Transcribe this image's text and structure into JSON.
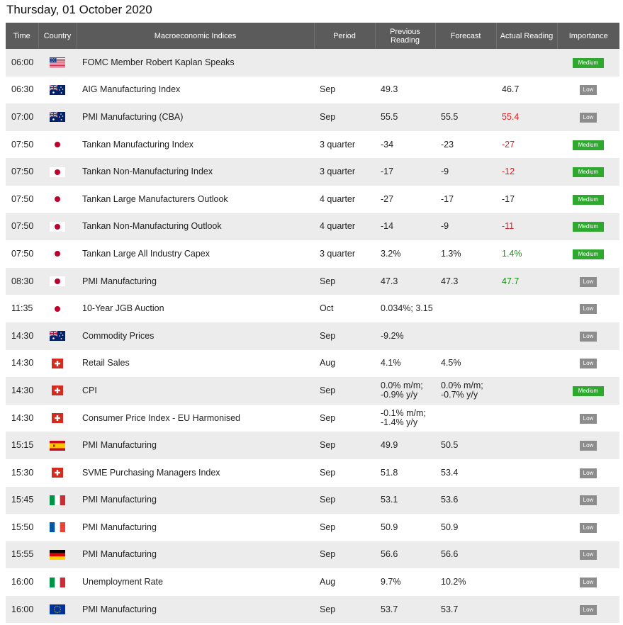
{
  "page_title": "Thursday, 01 October 2020",
  "headers": {
    "time": "Time",
    "country": "Country",
    "indices": "Macroeconomic Indices",
    "period": "Period",
    "previous_line1": "Previous",
    "previous_line2": "Reading",
    "forecast": "Forecast",
    "actual": "Actual Reading",
    "importance": "Importance"
  },
  "colors": {
    "header_bg": "#5b5b5b",
    "medium": "#2fa82f",
    "low": "#8c8c8c",
    "negative": "#e02020",
    "positive": "#1e8f1e"
  },
  "rows": [
    {
      "time": "06:00",
      "flag": "us-flag-icon",
      "index": "FOMC Member Robert Kaplan Speaks",
      "period": "",
      "prev": "",
      "forecast": "",
      "actual": "",
      "actual_color": "",
      "importance": "Medium"
    },
    {
      "time": "06:30",
      "flag": "au-flag-icon",
      "index": "AIG Manufacturing Index",
      "period": "Sep",
      "prev": "49.3",
      "forecast": "",
      "actual": "46.7",
      "actual_color": "",
      "importance": "Low"
    },
    {
      "time": "07:00",
      "flag": "au-flag-icon",
      "index": "PMI Manufacturing (CBA)",
      "period": "Sep",
      "prev": "55.5",
      "forecast": "55.5",
      "actual": "55.4",
      "actual_color": "red",
      "importance": "Low"
    },
    {
      "time": "07:50",
      "flag": "jp-flag-icon",
      "index": "Tankan Manufacturing Index",
      "period": "3 quarter",
      "prev": "-34",
      "forecast": "-23",
      "actual": "-27",
      "actual_color": "red",
      "importance": "Medium"
    },
    {
      "time": "07:50",
      "flag": "jp-flag-icon",
      "index": "Tankan Non-Manufacturing Index",
      "period": "3 quarter",
      "prev": "-17",
      "forecast": "-9",
      "actual": "-12",
      "actual_color": "red",
      "importance": "Medium"
    },
    {
      "time": "07:50",
      "flag": "jp-flag-icon",
      "index": "Tankan Large Manufacturers Outlook",
      "period": "4 quarter",
      "prev": "-27",
      "forecast": "-17",
      "actual": "-17",
      "actual_color": "",
      "importance": "Medium"
    },
    {
      "time": "07:50",
      "flag": "jp-flag-icon",
      "index": "Tankan Non-Manufacturing Outlook",
      "period": "4 quarter",
      "prev": "-14",
      "forecast": "-9",
      "actual": "-11",
      "actual_color": "red",
      "importance": "Medium"
    },
    {
      "time": "07:50",
      "flag": "jp-flag-icon",
      "index": "Tankan Large All Industry Capex",
      "period": "3 quarter",
      "prev": "3.2%",
      "forecast": "1.3%",
      "actual": "1.4%",
      "actual_color": "green",
      "importance": "Medium"
    },
    {
      "time": "08:30",
      "flag": "jp-flag-icon",
      "index": "PMI Manufacturing",
      "period": "Sep",
      "prev": "47.3",
      "forecast": "47.3",
      "actual": "47.7",
      "actual_color": "green",
      "importance": "Low"
    },
    {
      "time": "11:35",
      "flag": "jp-flag-icon",
      "index": "10-Year JGB Auction",
      "period": "Oct",
      "prev": "0.034%; 3.15",
      "forecast": "",
      "actual": "",
      "actual_color": "",
      "importance": "Low"
    },
    {
      "time": "14:30",
      "flag": "au-flag-icon",
      "index": "Commodity Prices",
      "period": "Sep",
      "prev": "-9.2%",
      "forecast": "",
      "actual": "",
      "actual_color": "",
      "importance": "Low"
    },
    {
      "time": "14:30",
      "flag": "ch-flag-icon",
      "index": "Retail Sales",
      "period": "Aug",
      "prev": "4.1%",
      "forecast": "4.5%",
      "actual": "",
      "actual_color": "",
      "importance": "Low"
    },
    {
      "time": "14:30",
      "flag": "ch-flag-icon",
      "index": "CPI",
      "period": "Sep",
      "prev": "0.0% m/m; -0.9% y/y",
      "forecast": "0.0% m/m; -0.7% y/y",
      "actual": "",
      "actual_color": "",
      "importance": "Medium"
    },
    {
      "time": "14:30",
      "flag": "ch-flag-icon",
      "index": "Consumer Price Index - EU Harmonised",
      "period": "Sep",
      "prev": "-0.1% m/m; -1.4% y/y",
      "forecast": "",
      "actual": "",
      "actual_color": "",
      "importance": "Low"
    },
    {
      "time": "15:15",
      "flag": "es-flag-icon",
      "index": "PMI Manufacturing",
      "period": "Sep",
      "prev": "49.9",
      "forecast": "50.5",
      "actual": "",
      "actual_color": "",
      "importance": "Low"
    },
    {
      "time": "15:30",
      "flag": "ch-flag-icon",
      "index": "SVME Purchasing Managers Index",
      "period": "Sep",
      "prev": "51.8",
      "forecast": "53.4",
      "actual": "",
      "actual_color": "",
      "importance": "Low"
    },
    {
      "time": "15:45",
      "flag": "it-flag-icon",
      "index": "PMI Manufacturing",
      "period": "Sep",
      "prev": "53.1",
      "forecast": "53.6",
      "actual": "",
      "actual_color": "",
      "importance": "Low"
    },
    {
      "time": "15:50",
      "flag": "fr-flag-icon",
      "index": "PMI Manufacturing",
      "period": "Sep",
      "prev": "50.9",
      "forecast": "50.9",
      "actual": "",
      "actual_color": "",
      "importance": "Low"
    },
    {
      "time": "15:55",
      "flag": "de-flag-icon",
      "index": "PMI Manufacturing",
      "period": "Sep",
      "prev": "56.6",
      "forecast": "56.6",
      "actual": "",
      "actual_color": "",
      "importance": "Low"
    },
    {
      "time": "16:00",
      "flag": "it-flag-icon",
      "index": "Unemployment Rate",
      "period": "Aug",
      "prev": "9.7%",
      "forecast": "10.2%",
      "actual": "",
      "actual_color": "",
      "importance": "Low"
    },
    {
      "time": "16:00",
      "flag": "eu-flag-icon",
      "index": "PMI Manufacturing",
      "period": "Sep",
      "prev": "53.7",
      "forecast": "53.7",
      "actual": "",
      "actual_color": "",
      "importance": "Low"
    }
  ]
}
